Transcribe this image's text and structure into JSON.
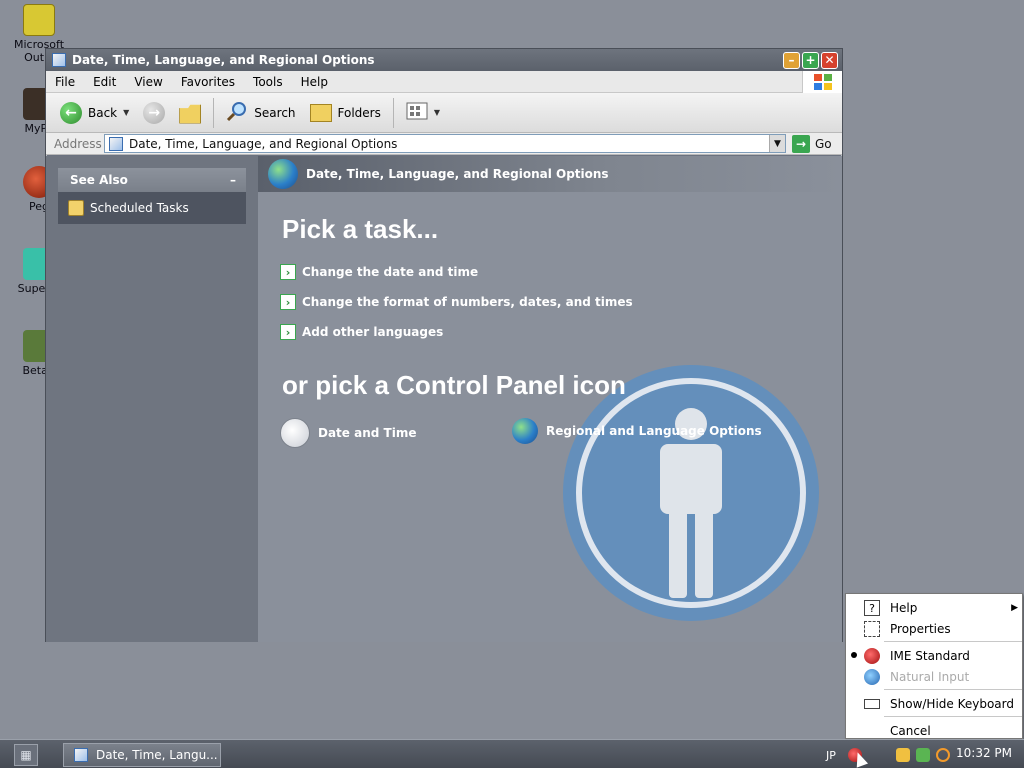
{
  "desktop": {
    "icons": [
      {
        "label": "Microsoft Outlo",
        "label2": "Outlo",
        "icon": "outlook-icon",
        "color": "#d8c833"
      },
      {
        "label": "MyPa",
        "icon": "mypa-icon",
        "color": "#3b2f26"
      },
      {
        "label": "Peg",
        "icon": "peg-icon",
        "color": "#b33a20"
      },
      {
        "label": "Superm",
        "icon": "superm-icon",
        "color": "#39c0a8"
      },
      {
        "label": "BetaC",
        "icon": "betac-icon",
        "color": "#5a7a3a"
      }
    ]
  },
  "window": {
    "title": "Date, Time, Language, and Regional Options",
    "buttons": {
      "min": "–",
      "max": "+",
      "close": "✕"
    },
    "menu": [
      "File",
      "Edit",
      "View",
      "Favorites",
      "Tools",
      "Help"
    ],
    "toolbar": {
      "back": "Back",
      "search": "Search",
      "folders": "Folders"
    },
    "address": {
      "label": "Address",
      "value": "Date, Time, Language, and Regional Options",
      "go": "Go"
    }
  },
  "sidebar": {
    "header": "See Also",
    "collapse": "–",
    "items": [
      {
        "label": "Scheduled Tasks"
      }
    ]
  },
  "main": {
    "header": "Date, Time, Language, and Regional Options",
    "pick_task": "Pick a task...",
    "tasks": [
      {
        "label": "Change the date and time"
      },
      {
        "label": "Change the format of numbers, dates, and times"
      },
      {
        "label": "Add other languages"
      }
    ],
    "pick_icon": "or pick a Control Panel icon",
    "icons": [
      {
        "label": "Date and Time"
      },
      {
        "label": "Regional and Language Options"
      }
    ]
  },
  "context_menu": {
    "items": [
      {
        "label": "Help",
        "has_submenu": true
      },
      {
        "label": "Properties"
      },
      {
        "label": "IME Standard",
        "checked": true
      },
      {
        "label": "Natural Input",
        "disabled": true
      },
      {
        "label": "Show/Hide Keyboard"
      },
      {
        "label": "Cancel"
      }
    ]
  },
  "taskbar": {
    "task_button": "Date, Time, Langu...",
    "language": "JP",
    "clock": "10:32 PM"
  },
  "colors": {
    "accent_green": "#3aa650",
    "window_bg": "#8a909b",
    "desktop_bg": "#8a8f99"
  }
}
